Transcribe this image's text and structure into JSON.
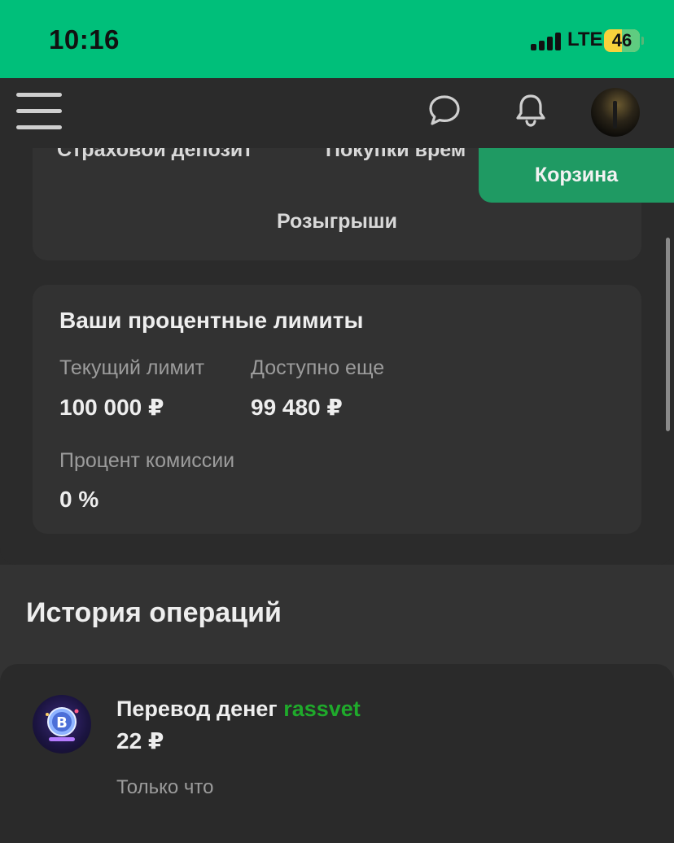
{
  "status_bar": {
    "time": "10:16",
    "network": "LTE",
    "battery": "46",
    "background": "#00bf7a"
  },
  "header": {
    "menu_icon": "hamburger-icon",
    "chat_icon": "chat-bubble-icon",
    "notification_icon": "bell-icon",
    "avatar": "avatar"
  },
  "top_card": {
    "tabs": [
      "Страховой депозит",
      "Покупки врем"
    ],
    "draws_label": "Розыгрыши"
  },
  "cart_button": {
    "label": "Корзина",
    "color": "#1f9a63"
  },
  "limits": {
    "title": "Ваши процентные лимиты",
    "current_limit_label": "Текущий лимит",
    "current_limit_value": "100 000 ₽",
    "available_label": "Доступно еще",
    "available_value": "99 480 ₽",
    "commission_label": "Процент комиссии",
    "commission_value": "0 %"
  },
  "history": {
    "title": "История операций",
    "items": [
      {
        "title": "Перевод денег",
        "user": "rassvet",
        "user_color": "#1faa2b",
        "amount": "22 ₽",
        "time": "Только что",
        "icon": "bitcoin-icon"
      }
    ]
  }
}
